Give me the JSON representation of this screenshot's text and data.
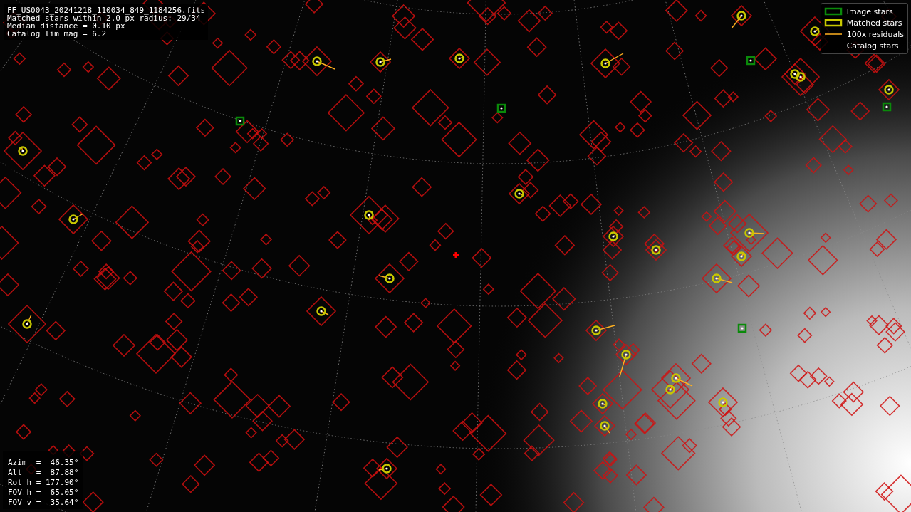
{
  "header": {
    "lines": [
      "FF_US0043_20241218_110034_849_1184256.fits",
      "Matched stars within 2.0 px radius: 29/34",
      "Median distance = 0.10 px",
      "Catalog lim mag = 6.2"
    ]
  },
  "legend": {
    "items": [
      {
        "kind": "image",
        "label": "Image stars"
      },
      {
        "kind": "matched",
        "label": "Matched stars"
      },
      {
        "kind": "residual",
        "label": "100x residuals"
      },
      {
        "kind": "catalog",
        "label": "Catalog stars"
      }
    ]
  },
  "pointing": {
    "lines": [
      "Azim  =  46.35°",
      "Alt   =  87.88°",
      "Rot h = 177.90°",
      "FOV h =  65.05°",
      "FOV v =  35.64°"
    ]
  }
}
